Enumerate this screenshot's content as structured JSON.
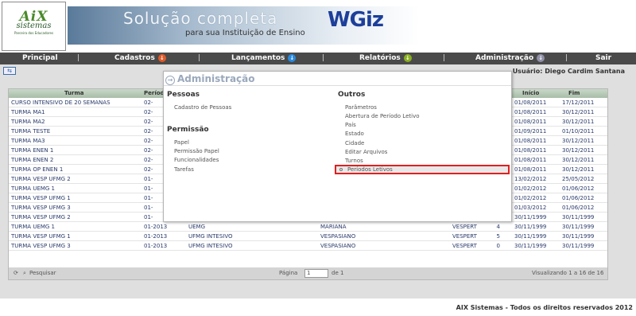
{
  "logo": {
    "line1": "AiX",
    "line2": "sistemas",
    "line3": "Parceira dos Educadores"
  },
  "banner": {
    "headline": "Solução completa",
    "subline": "para sua Instituição de Ensino",
    "brand": "WGiz"
  },
  "nav": {
    "items": [
      {
        "label": "Principal"
      },
      {
        "label": "Cadastros",
        "icon": "arrow-down-icon",
        "color": "#e05a2a"
      },
      {
        "label": "Lançamentos",
        "icon": "arrow-down-icon",
        "color": "#2a8ae0"
      },
      {
        "label": "Relatórios",
        "icon": "arrow-down-icon",
        "color": "#8ab020"
      },
      {
        "label": "Administração",
        "icon": "arrow-down-icon",
        "color": "#9090a8"
      },
      {
        "label": "Sair"
      }
    ],
    "separator": "|"
  },
  "user_label": "Usuário: Diego Cardim Santana",
  "table": {
    "headers": [
      "Turma",
      "Período",
      "",
      "",
      "",
      "",
      "Início",
      "Fim"
    ],
    "rows": [
      [
        "CURSO INTENSIVO DE 20 SEMANAS",
        "02-",
        "",
        "",
        "",
        "",
        "01/08/2011",
        "17/12/2011"
      ],
      [
        "TURMA MA1",
        "02-",
        "",
        "",
        "",
        "",
        "01/08/2011",
        "30/12/2011"
      ],
      [
        "TURMA MA2",
        "02-",
        "",
        "",
        "",
        "",
        "01/08/2011",
        "30/12/2011"
      ],
      [
        "TURMA TESTE",
        "02-",
        "",
        "",
        "",
        "",
        "01/09/2011",
        "01/10/2011"
      ],
      [
        "TURMA MA3",
        "02-",
        "",
        "",
        "",
        "",
        "01/08/2011",
        "30/12/2011"
      ],
      [
        "TURMA ENEN 1",
        "02-",
        "",
        "",
        "",
        "",
        "01/08/2011",
        "30/12/2011"
      ],
      [
        "TURMA ENEN 2",
        "02-",
        "",
        "",
        "",
        "",
        "01/08/2011",
        "30/12/2011"
      ],
      [
        "TURMA OP ENEN 1",
        "02-",
        "",
        "",
        "",
        "",
        "01/08/2011",
        "30/12/2011"
      ],
      [
        "TURMA VESP UFMG 2",
        "01-",
        "",
        "",
        "",
        "",
        "13/02/2012",
        "25/05/2012"
      ],
      [
        "TURMA UEMG 1",
        "01-",
        "",
        "",
        "",
        "",
        "01/02/2012",
        "01/06/2012"
      ],
      [
        "TURMA VESP UFMG 1",
        "01-",
        "",
        "",
        "",
        "",
        "01/02/2012",
        "01/06/2012"
      ],
      [
        "TURMA VESP UFMG 3",
        "01-",
        "",
        "",
        "",
        "",
        "01/03/2012",
        "01/06/2012"
      ],
      [
        "TURMA VESP UFMG 2",
        "01-",
        "",
        "",
        "",
        "",
        "30/11/1999",
        "30/11/1999"
      ],
      [
        "TURMA UEMG 1",
        "01-2013",
        "UEMG",
        "MARIANA",
        "VESPERT",
        "4",
        "30/11/1999",
        "30/11/1999"
      ],
      [
        "TURMA VESP UFMG 1",
        "01-2013",
        "UFMG INTESIVO",
        "VESPASIANO",
        "VESPERT",
        "5",
        "30/11/1999",
        "30/11/1999"
      ],
      [
        "TURMA VESP UFMG 3",
        "01-2013",
        "UFMG INTESIVO",
        "VESPASIANO",
        "VESPERT",
        "0",
        "30/11/1999",
        "30/11/1999"
      ]
    ]
  },
  "grid_footer": {
    "search": "Pesquisar",
    "page_label": "Página",
    "page_value": "1",
    "of_label": "de 1",
    "summary": "Visualizando 1 a 16 de 16"
  },
  "menu": {
    "title": "Administração",
    "pessoas": {
      "heading": "Pessoas",
      "items": [
        "Cadastro de Pessoas"
      ]
    },
    "permissao": {
      "heading": "Permissão",
      "items": [
        "Papel",
        "Permissão Papel",
        "Funcionalidades",
        "Tarefas"
      ]
    },
    "outros": {
      "heading": "Outros",
      "items": [
        "Parâmetros",
        "Abertura de Período Letivo",
        "País",
        "Estado",
        "Cidade",
        "Editar Arquivos",
        "Turnos",
        "Períodos Letivos"
      ]
    }
  },
  "footer": "AIX Sistemas - Todos os direitos reservados 2012"
}
